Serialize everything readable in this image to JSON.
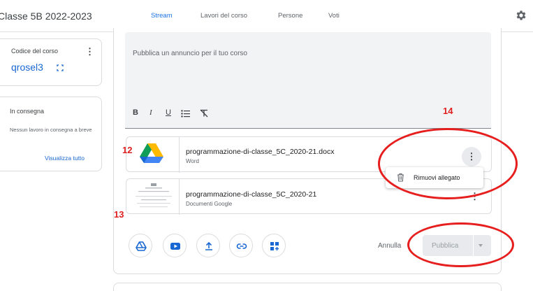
{
  "header": {
    "class_title": "Classe 5B 2022-2023",
    "tabs": [
      {
        "label": "Stream",
        "active": true
      },
      {
        "label": "Lavori del corso",
        "active": false
      },
      {
        "label": "Persone",
        "active": false
      },
      {
        "label": "Voti",
        "active": false
      }
    ],
    "settings_icon": "gear-icon"
  },
  "sidebar": {
    "course_code_label": "Codice del corso",
    "course_code": "qrosel3",
    "due_title": "In consegna",
    "due_text": "Nessun lavoro in consegna a breve",
    "view_all": "Visualizza tutto"
  },
  "composer": {
    "placeholder": "Pubblica un annuncio per il tuo corso",
    "format_buttons": [
      "B",
      "I",
      "U"
    ],
    "attachments": [
      {
        "name": "programmazione-di-classe_5C_2020-21.docx",
        "type": "Word",
        "icon": "google-drive-icon"
      },
      {
        "name": "programmazione-di-classe_5C_2020-21",
        "type": "Documenti Google",
        "icon": "doc-thumbnail"
      }
    ],
    "menu_item": "Rimuovi allegato",
    "cancel_label": "Annulla",
    "publish_label": "Pubblica",
    "tools": [
      "drive-icon",
      "youtube-icon",
      "upload-icon",
      "link-icon",
      "add-apps-icon"
    ]
  },
  "annotations": {
    "n12": "12",
    "n13": "13",
    "n14": "14",
    "color": "#e02020"
  }
}
